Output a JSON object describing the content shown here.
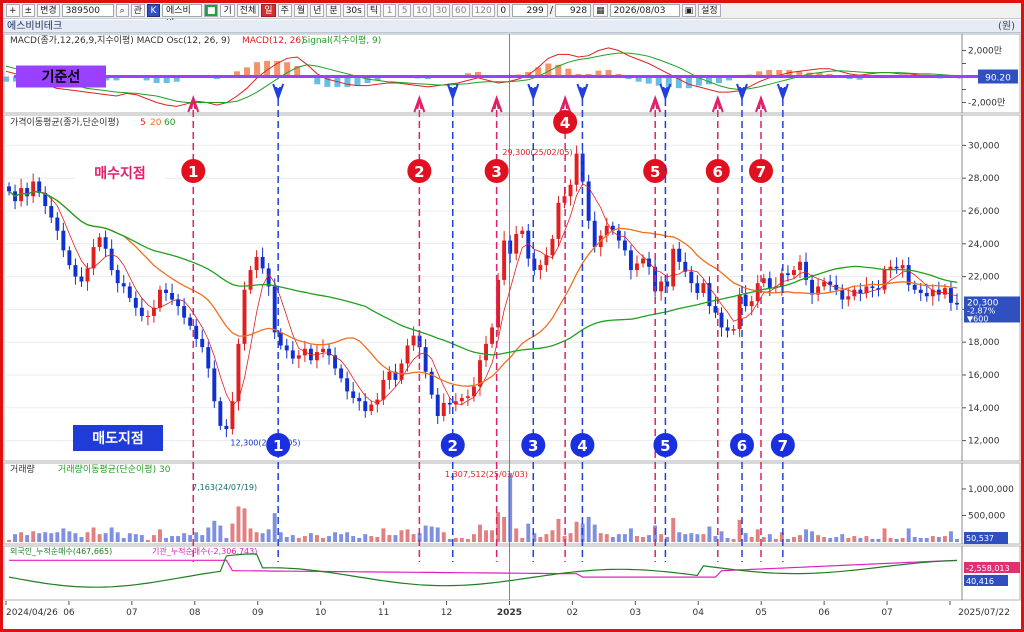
{
  "toolbar": {
    "change_label": "변경",
    "code_value": "389500",
    "search_icon": "magnifier-icon",
    "mode_label": "관",
    "stock_name": "에스비비",
    "period_buttons": [
      "기",
      "전체",
      "일",
      "주",
      "월",
      "년",
      "분",
      "30s",
      "틱"
    ],
    "interval_buttons": [
      "1",
      "5",
      "10",
      "30",
      "60",
      "120"
    ],
    "zero_label": "0",
    "count_value": "299",
    "total_value": "928",
    "date_value": "2026/08/03",
    "settings_label": "설정"
  },
  "title_bar": {
    "name": "에스비비테크",
    "unit": "(원)"
  },
  "colors": {
    "up": "#e02020",
    "down": "#1030d0",
    "ma5": "#e02020",
    "ma20": "#f07020",
    "ma60": "#20a020",
    "macd": "#e02020",
    "signal": "#20a020",
    "buy": "#e0206a",
    "sell": "#2040e0",
    "base": "#9a40ff",
    "foreign": "#208020",
    "inst": "#e020c0"
  },
  "chart_data": [
    {
      "type": "line",
      "name": "macd",
      "label": "MACD(종가,12,26,9,지수이평) MACD Osc(12, 26, 9)",
      "legend": [
        "MACD(12, 26)",
        "Signal(지수이평, 9)"
      ],
      "x": [
        0,
        10,
        20,
        30,
        40,
        50,
        60,
        70,
        80,
        90,
        100,
        110,
        120,
        130,
        140,
        150,
        160,
        170,
        180,
        190,
        200,
        210,
        220,
        230,
        240,
        250,
        260,
        270,
        280,
        290,
        300,
        310,
        320,
        330,
        340,
        350,
        360,
        370,
        380,
        390,
        400,
        410,
        420,
        430,
        440,
        450,
        460,
        470,
        480,
        490,
        500,
        510,
        520,
        530,
        540,
        550,
        560,
        570,
        580,
        590,
        600,
        610,
        620,
        630,
        640,
        650,
        660,
        670,
        680,
        690,
        700,
        710,
        720,
        730,
        740,
        750,
        760,
        770,
        780,
        790,
        800,
        810,
        820,
        830,
        840,
        850,
        860,
        870,
        880,
        890,
        900,
        910,
        920,
        930,
        940,
        950
      ],
      "macd": [
        400,
        200,
        0,
        -300,
        -600,
        -900,
        -1000,
        -1100,
        -1200,
        -1300,
        -1400,
        -1500,
        -1300,
        -1400,
        -1700,
        -2000,
        -2200,
        -2300,
        -2100,
        -1900,
        -2000,
        -2200,
        -2000,
        -1500,
        -900,
        -100,
        500,
        1000,
        1400,
        1500,
        900,
        200,
        -200,
        -400,
        -600,
        -700,
        -700,
        -600,
        -500,
        -500,
        -600,
        -700,
        -800,
        -700,
        -600,
        -500,
        -300,
        -100,
        -300,
        -500,
        -400,
        -200,
        100,
        700,
        1400,
        1700,
        1700,
        1500,
        1600,
        2000,
        2200,
        2000,
        1600,
        1300,
        1000,
        600,
        200,
        -200,
        -600,
        -800,
        -1000,
        -1200,
        -1200,
        -1100,
        -800,
        -400,
        -100,
        100,
        300,
        400,
        500,
        600,
        600,
        400,
        200,
        100,
        200,
        300,
        300,
        200,
        200,
        100,
        100,
        0,
        0,
        -100
      ],
      "signal": [
        800,
        600,
        400,
        200,
        0,
        -300,
        -500,
        -700,
        -900,
        -1000,
        -1100,
        -1200,
        -1250,
        -1300,
        -1400,
        -1500,
        -1700,
        -1900,
        -2000,
        -2000,
        -2000,
        -2000,
        -2000,
        -1900,
        -1600,
        -1200,
        -700,
        -200,
        300,
        700,
        900,
        800,
        600,
        400,
        200,
        0,
        -200,
        -300,
        -400,
        -450,
        -500,
        -550,
        -600,
        -650,
        -650,
        -600,
        -550,
        -450,
        -400,
        -400,
        -400,
        -350,
        -250,
        0,
        400,
        800,
        1100,
        1300,
        1400,
        1550,
        1700,
        1800,
        1800,
        1700,
        1550,
        1300,
        1000,
        700,
        300,
        -100,
        -400,
        -700,
        -900,
        -1000,
        -950,
        -800,
        -600,
        -400,
        -200,
        0,
        200,
        300,
        400,
        450,
        400,
        350,
        300,
        300,
        300,
        300,
        250,
        200,
        200,
        150,
        100,
        50
      ],
      "baseline_label": "기준선",
      "baseline_value": "90.20",
      "ticks": [
        "2,000만",
        "1,000만",
        "0",
        "-1,000만",
        "-2,000만"
      ],
      "ylim": [
        -2500,
        2500
      ]
    },
    {
      "type": "candlestick",
      "name": "price",
      "label": "가격이동평균(종가,단순이평)",
      "ma_periods": [
        "5",
        "20",
        "60"
      ],
      "x_dates": [
        "2024/04/26",
        "06",
        "07",
        "08",
        "09",
        "10",
        "11",
        "12",
        "2025",
        "02",
        "03",
        "04",
        "05",
        "06",
        "07",
        "2025/07/22"
      ],
      "close": [
        27200,
        26600,
        27400,
        26900,
        27800,
        27100,
        26300,
        25600,
        24800,
        23600,
        22700,
        22000,
        21700,
        22500,
        23800,
        24400,
        23700,
        22400,
        21600,
        21400,
        20700,
        20100,
        19600,
        19600,
        20100,
        21200,
        21000,
        20600,
        20200,
        19500,
        19000,
        18200,
        17700,
        16400,
        14400,
        12900,
        12700,
        14400,
        17900,
        21200,
        22400,
        23200,
        22500,
        21400,
        18600,
        17800,
        17500,
        17000,
        17200,
        17600,
        16900,
        17400,
        17600,
        17200,
        16400,
        15800,
        15000,
        14600,
        14400,
        13800,
        14200,
        14500,
        15700,
        16200,
        15700,
        16700,
        17800,
        18400,
        17700,
        16200,
        14800,
        13500,
        14300,
        14200,
        14400,
        14600,
        14700,
        15300,
        16900,
        17900,
        18900,
        21800,
        24200,
        23400,
        24600,
        24800,
        23100,
        22400,
        22700,
        23300,
        24300,
        26500,
        26900,
        27600,
        29500,
        27800,
        25400,
        23800,
        24500,
        25100,
        24800,
        24200,
        23600,
        22400,
        22800,
        23100,
        22600,
        21100,
        21700,
        21400,
        23700,
        22900,
        22300,
        21600,
        21000,
        21600,
        20200,
        19800,
        18900,
        18700,
        18800,
        20900,
        20200,
        20500,
        21600,
        21900,
        21300,
        21400,
        22200,
        22100,
        22400,
        22900,
        21800,
        20900,
        21400,
        21700,
        21500,
        21200,
        20600,
        20800,
        21200,
        21000,
        21400,
        21300,
        21200,
        22400,
        22600,
        22500,
        22700,
        21500,
        21200,
        21000,
        20800,
        21200,
        20900,
        21300,
        20400,
        20300
      ],
      "ma_highlights": {
        "high_label": "29,300(25/02/05)",
        "low_label": "12,300(24/08/05)"
      },
      "last_price": "20,300",
      "change_pct": "-2.87%",
      "change_val": "▼600",
      "y_ticks": [
        "30,000",
        "28,000",
        "26,000",
        "24,000",
        "22,000",
        "20,000",
        "18,000",
        "16,000",
        "14,000",
        "12,000"
      ],
      "ylim": [
        11000,
        31000
      ],
      "buy_label": "매수지점",
      "sell_label": "매도지점",
      "buy_points": [
        {
          "n": "1",
          "x": 0.1963
        },
        {
          "n": "2",
          "x": 0.4333
        },
        {
          "n": "3",
          "x": 0.5143
        },
        {
          "n": "4",
          "x": 0.5861
        },
        {
          "n": "5",
          "x": 0.6805
        },
        {
          "n": "6",
          "x": 0.7461
        },
        {
          "n": "7",
          "x": 0.7914
        }
      ],
      "sell_points": [
        {
          "n": "1",
          "x": 0.2853
        },
        {
          "n": "2",
          "x": 0.4683
        },
        {
          "n": "3",
          "x": 0.5527
        },
        {
          "n": "4",
          "x": 0.6042
        },
        {
          "n": "5",
          "x": 0.6912
        },
        {
          "n": "6",
          "x": 0.7715
        },
        {
          "n": "7",
          "x": 0.8143
        }
      ]
    },
    {
      "type": "bar",
      "name": "volume",
      "label": "거래량",
      "ma_label": "거래량이동평균(단순이평) 30",
      "annot_1": "7,163(24/07/19)",
      "annot_2": "1,307,512(25/01/03)",
      "ticks": [
        "1,000,000",
        "500,000"
      ],
      "last": "50,537",
      "ylim": [
        0,
        1300000
      ]
    },
    {
      "type": "line",
      "name": "flows",
      "legend_foreign": "외국인_누적순매수(467,665)",
      "legend_inst": "기관_누적순매수(-2,306,743)",
      "last_inst": "-2,558,013",
      "last_foreign": "40,416"
    }
  ]
}
